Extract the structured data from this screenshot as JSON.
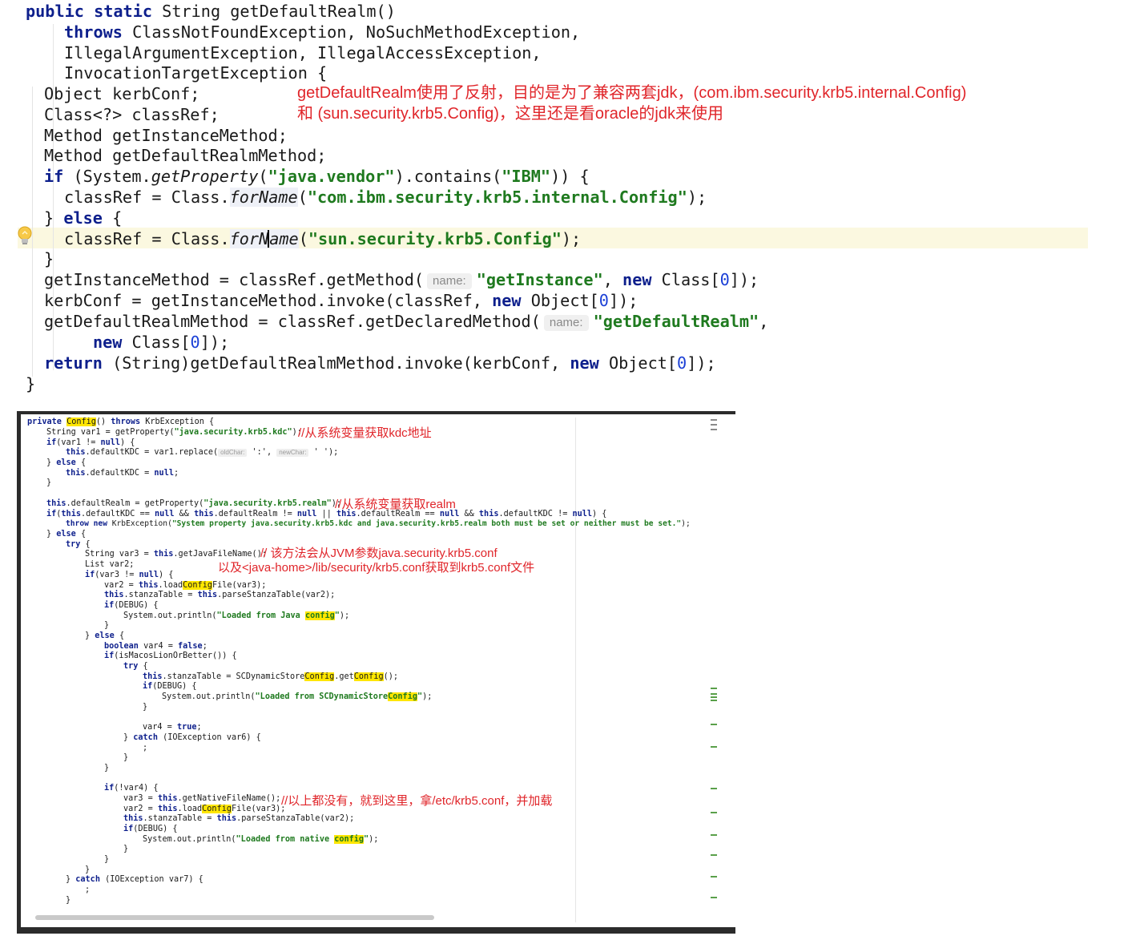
{
  "top_code": {
    "l1": {
      "kw": "public static",
      "rest": " String getDefaultRealm()"
    },
    "l2": {
      "kw": "throws",
      "rest": " ClassNotFoundException, NoSuchMethodException,"
    },
    "l3": "IllegalArgumentException, IllegalAccessException,",
    "l4": "InvocationTargetException {",
    "l5": "Object kerbConf;",
    "l6": "Class<?> classRef;",
    "l7": "Method getInstanceMethod;",
    "l8": "Method getDefaultRealmMethod;",
    "l9": {
      "kw": "if",
      "p1": " (System.",
      "m": "getProperty",
      "p2": "(",
      "s1": "\"java.vendor\"",
      "p3": ").contains(",
      "s2": "\"IBM\"",
      "p4": ")) {"
    },
    "l10": {
      "p1": "classRef = Class.",
      "m": "forName",
      "p2": "(",
      "s": "\"com.ibm.security.krb5.internal.Config\"",
      "p3": ");"
    },
    "l11": {
      "p1": "} ",
      "kw": "else",
      "p2": " {"
    },
    "l12": {
      "p1": "classRef = Class.",
      "m1": "forN",
      "m2": "ame",
      "p2": "(",
      "s": "\"sun.security.krb5.Config\"",
      "p3": ");"
    },
    "l13": "}",
    "l14": {
      "p1": "getInstanceMethod = classRef.getMethod(",
      "hint": "name:",
      "s": "\"getInstance\"",
      "p2": ", ",
      "kw": "new",
      "p3": " Class[",
      "n": "0",
      "p4": "]);"
    },
    "l15": {
      "p1": "kerbConf = getInstanceMethod.invoke(classRef, ",
      "kw": "new",
      "p2": " Object[",
      "n": "0",
      "p3": "]);"
    },
    "l16": {
      "p1": "getDefaultRealmMethod = classRef.getDeclaredMethod(",
      "hint": "name:",
      "s": "\"getDefaultRealm\"",
      "p2": ","
    },
    "l17": {
      "kw": "new",
      "p1": " Class[",
      "n": "0",
      "p2": "]);"
    },
    "l18": {
      "kw": "return",
      "p1": " (String)getDefaultRealmMethod.invoke(kerbConf, ",
      "kw2": "new",
      "p2": " Object[",
      "n": "0",
      "p3": "]);"
    },
    "l19": "}"
  },
  "top_annotation": {
    "line1": "getDefaultRealm使用了反射，目的是为了兼容两套jdk，(com.ibm.security.krb5.internal.Config)",
    "line2": "和 (sun.security.krb5.Config)，这里还是看oracle的jdk来使用"
  },
  "bottom_code": {
    "s1": {
      "kw": "private",
      "sp": " ",
      "mark": "Config",
      "p": "() ",
      "kw2": "throws",
      "p2": " KrbException {"
    },
    "s2": {
      "p": "String var1 = getProperty(",
      "s": "\"java.security.krb5.kdc\"",
      "p2": ");"
    },
    "s3": {
      "kw": "if",
      "p": "(var1 != ",
      "kw2": "null",
      "p2": ") {"
    },
    "s4": {
      "kw": "this",
      "p": ".defaultKDC = var1.replace(",
      "h1": "oldChar:",
      "p2": " ':', ",
      "h2": "newChar:",
      "p3": " ' ');"
    },
    "s5": {
      "p": "} ",
      "kw": "else",
      "p2": " {"
    },
    "s6": {
      "kw": "this",
      "p": ".defaultKDC = ",
      "kw2": "null",
      "p2": ";"
    },
    "s7": "}",
    "s8": {
      "kw": "this",
      "p": ".defaultRealm = getProperty(",
      "s": "\"java.security.krb5.realm\"",
      "p2": ");"
    },
    "s9": {
      "kw": "if",
      "p": "(",
      "kw2": "this",
      "p2": ".defaultKDC == ",
      "kw3": "null",
      "p3": " && ",
      "kw4": "this",
      "p4": ".defaultRealm != ",
      "kw5": "null",
      "p5": " || ",
      "kw6": "this",
      "p6": ".defaultRealm == ",
      "kw7": "null",
      "p7": " && ",
      "kw8": "this",
      "p8": ".defaultKDC != ",
      "kw9": "null",
      "p9": ") {"
    },
    "s10": {
      "kw": "throw new",
      "p": " KrbException(",
      "s": "\"System property java.security.krb5.kdc and java.security.krb5.realm both must be set or neither must be set.\"",
      "p2": ");"
    },
    "s11": {
      "p": "} ",
      "kw": "else",
      "p2": " {"
    },
    "s12": {
      "kw": "try",
      "p": " {"
    },
    "s13": {
      "p": "String var3 = ",
      "kw": "this",
      "p2": ".getJavaFileName();"
    },
    "s14": "List var2;",
    "s15": {
      "kw": "if",
      "p": "(var3 != ",
      "kw2": "null",
      "p2": ") {"
    },
    "s16": {
      "p": "var2 = ",
      "kw": "this",
      "p2": ".load",
      "mark": "Config",
      "p3": "File(var3);"
    },
    "s17": {
      "kw": "this",
      "p": ".stanzaTable = ",
      "kw2": "this",
      "p2": ".parseStanzaTable(var2);"
    },
    "s18": {
      "kw": "if",
      "p": "(DEBUG) {"
    },
    "s19": {
      "p": "System.out.println(",
      "s": "\"Loaded from Java ",
      "mark": "config",
      "s2": "\"",
      "p2": ");"
    },
    "s20": "}",
    "s21": {
      "p": "} ",
      "kw": "else",
      "p2": " {"
    },
    "s22": {
      "kw": "boolean",
      "p": " var4 = ",
      "kw2": "false",
      "p2": ";"
    },
    "s23": {
      "kw": "if",
      "p": "(isMacosLionOrBetter()) {"
    },
    "s24": {
      "kw": "try",
      "p": " {"
    },
    "s25": {
      "kw": "this",
      "p": ".stanzaTable = SCDynamicStore",
      "mark": "Config",
      "p2": ".get",
      "mark2": "Config",
      "p3": "();"
    },
    "s26": {
      "kw": "if",
      "p": "(DEBUG) {"
    },
    "s27": {
      "p": "System.out.println(",
      "s": "\"Loaded from SCDynamicStore",
      "mark": "Config",
      "s2": "\"",
      "p2": ");"
    },
    "s28": "}",
    "s29": {
      "p": "var4 = ",
      "kw": "true",
      "p2": ";"
    },
    "s30": {
      "p": "} ",
      "kw": "catch",
      "p2": " (IOException var6) {"
    },
    "s31": ";",
    "s32": "}",
    "s33": "}",
    "s34": {
      "kw": "if",
      "p": "(!var4) {"
    },
    "s35": {
      "p": "var3 = ",
      "kw": "this",
      "p2": ".getNativeFileName();"
    },
    "s36": {
      "p": "var2 = ",
      "kw": "this",
      "p2": ".load",
      "mark": "Config",
      "p3": "File(var3);"
    },
    "s37": {
      "kw": "this",
      "p": ".stanzaTable = ",
      "kw2": "this",
      "p2": ".parseStanzaTable(var2);"
    },
    "s38": {
      "kw": "if",
      "p": "(DEBUG) {"
    },
    "s39": {
      "p": "System.out.println(",
      "s": "\"Loaded from native ",
      "mark": "config",
      "s2": "\"",
      "p2": ");"
    },
    "s40": "}",
    "s41": "}",
    "s42": "}",
    "s43": {
      "p": "} ",
      "kw": "catch",
      "p2": " (IOException var7) {"
    },
    "s44": ";",
    "s45": "}"
  },
  "bottom_annotations": {
    "a1": "//从系统变量获取kdc地址",
    "a2": "//从系统变量获取realm",
    "a3": "// 该方法会从JVM参数java.security.krb5.conf",
    "a4": "以及<java-home>/lib/security/krb5.conf获取到krb5.conf文件",
    "a5": "//以上都没有，就到这里，拿/etc/krb5.conf，并加载"
  },
  "colors": {
    "keyword": "#0d1f8c",
    "string": "#1f7a1f",
    "annotation": "#e0252a",
    "search_highlight": "#ffe600",
    "current_line": "#fbf8e0"
  },
  "icons": {
    "lightbulb": "lightbulb-icon"
  }
}
